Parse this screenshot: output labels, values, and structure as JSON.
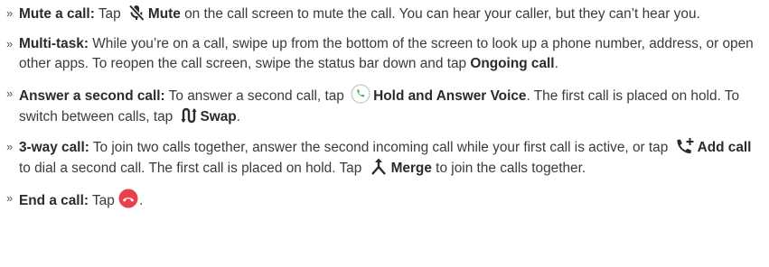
{
  "bullet": "»",
  "items": [
    {
      "title": "Mute a call:",
      "t1": " Tap ",
      "icon": "mute-mic-icon",
      "bold1": "Mute",
      "t2": " on the call screen to mute the call. You can hear your caller, but they can’t hear you."
    },
    {
      "title": "Multi-task:",
      "t1": " While you’re on a call, swipe up from the bottom of the screen to look up a phone number, address, or open other apps. To reopen the call screen, swipe the status bar down and tap ",
      "bold1": "Ongoing call",
      "t2": "."
    },
    {
      "title": "Answer a second call:",
      "t1": " To answer a second call, tap ",
      "icon1": "green-phone-icon",
      "bold1": "Hold and Answer Voice",
      "t2": ". The first call is placed on hold. To switch between calls, tap ",
      "icon2": "swap-arrows-icon",
      "bold2": "Swap",
      "t3": "."
    },
    {
      "title": "3-way call:",
      "t1": " To join two calls together, answer the second incoming call while your first call is active, or tap ",
      "icon1": "add-call-icon",
      "bold1": "Add call",
      "t2": " to dial a second call. The first call is placed on hold. Tap ",
      "icon2": "merge-icon",
      "bold2": "Merge",
      "t3": " to join the calls together."
    },
    {
      "title": "End a call:",
      "t1": " Tap ",
      "icon": "end-call-icon",
      "t2": "."
    }
  ],
  "colors": {
    "text": "#3a3a3a",
    "answer_green": "#3bb54a",
    "end_red": "#e8414b"
  }
}
